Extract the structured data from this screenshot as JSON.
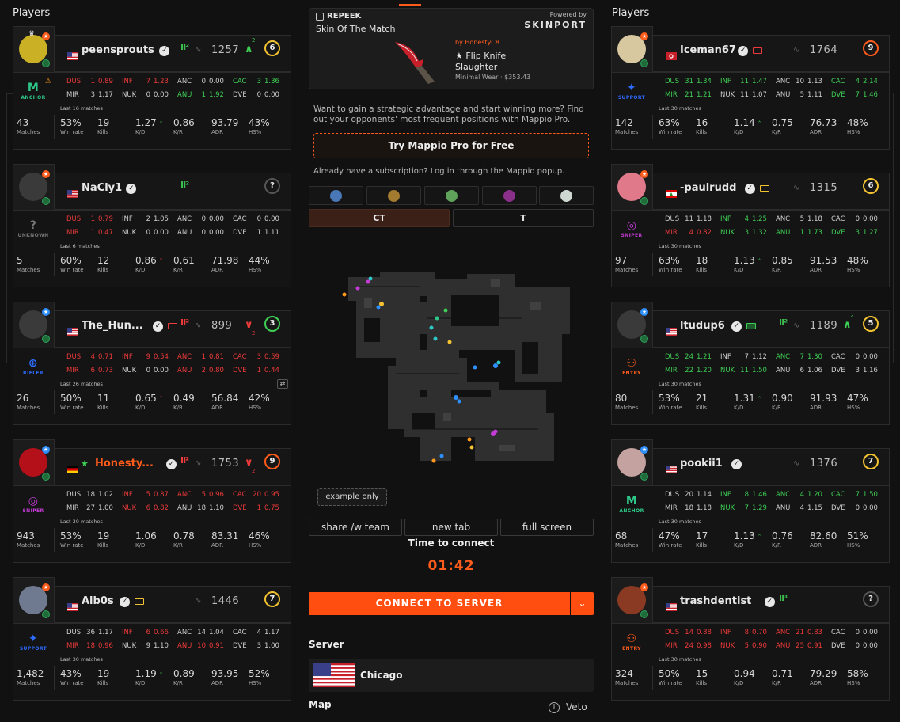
{
  "left_title": "Players",
  "right_title": "Players",
  "left_players": [
    {
      "name": "peensprouts",
      "name_color": "#e8e8e8",
      "flag": "us",
      "lvl": "Ⅱ²",
      "elo": "1257",
      "trend": "∧",
      "trend_sub": "2",
      "trend_color": "#3ecf55",
      "level": "6",
      "ring": "#f2c230",
      "role": "ANCHOR",
      "role_color": "#2ec98a",
      "role_icon": "M",
      "last": "Last 16 matches",
      "avatar_bg": "#c9b025",
      "dot": "#ff5c1c",
      "maps": [
        [
          "DUS",
          "1",
          "0.89",
          "INF",
          "7",
          "1.23",
          "ANC",
          "0",
          "0.00",
          "CAC",
          "3",
          "1.36"
        ],
        [
          "MIR",
          "3",
          "1.17",
          "NUK",
          "0",
          "0.00",
          "ANU",
          "1",
          "1.92",
          "DVE",
          "0",
          "0.00"
        ]
      ],
      "mapcolors": [
        [
          "rd",
          "rd",
          "w",
          "g"
        ],
        [
          "w",
          "w",
          "g",
          "w"
        ]
      ],
      "stats": {
        "matches": "43",
        "winrate": "53%",
        "kills": "19",
        "kd": "1.27",
        "kd_arrow": "˄",
        "kr": "0.86",
        "adr": "93.79",
        "hs": "43%"
      }
    },
    {
      "name": "NaCly1",
      "name_color": "#e8e8e8",
      "flag": "us",
      "lvl": "Ⅱ²",
      "elo": "",
      "trend": "",
      "trend_sub": "",
      "trend_color": "#3ecf55",
      "level": "?",
      "ring": "#555",
      "role": "UNKNOWN",
      "role_color": "#777",
      "role_icon": "?",
      "last": "Last 6 matches",
      "avatar_bg": "#3a3a3a",
      "dot": "#ff5c1c",
      "maps": [
        [
          "DUS",
          "1",
          "0.79",
          "INF",
          "2",
          "1.05",
          "ANC",
          "0",
          "0.00",
          "CAC",
          "0",
          "0.00"
        ],
        [
          "MIR",
          "1",
          "0.47",
          "NUK",
          "0",
          "0.00",
          "ANU",
          "0",
          "0.00",
          "DVE",
          "1",
          "1.11"
        ]
      ],
      "mapcolors": [
        [
          "rd",
          "w",
          "w",
          "w"
        ],
        [
          "rd",
          "w",
          "w",
          "w"
        ]
      ],
      "stats": {
        "matches": "5",
        "winrate": "60%",
        "kills": "12",
        "kd": "0.86",
        "kd_arrow": "˅",
        "kr": "0.61",
        "adr": "71.98",
        "hs": "44%"
      }
    },
    {
      "name": "The_Hun...",
      "name_color": "#e8e8e8",
      "flag": "us",
      "lvl": "Ⅱ²",
      "elo": "899",
      "trend": "∨",
      "trend_sub": "2",
      "trend_color": "#ee3a3a",
      "level": "3",
      "ring": "#3ecf55",
      "role": "RIFLER",
      "role_color": "#2e6bff",
      "role_icon": "⊕",
      "last": "Last 26 matches",
      "avatar_bg": "#3a3a3a",
      "dot": "#2e8fff",
      "maps": [
        [
          "DUS",
          "4",
          "0.71",
          "INF",
          "9",
          "0.54",
          "ANC",
          "1",
          "0.81",
          "CAC",
          "3",
          "0.59"
        ],
        [
          "MIR",
          "6",
          "0.73",
          "NUK",
          "0",
          "0.00",
          "ANU",
          "2",
          "0.80",
          "DVE",
          "1",
          "0.44"
        ]
      ],
      "mapcolors": [
        [
          "rd",
          "rd",
          "rd",
          "rd"
        ],
        [
          "rd",
          "w",
          "rd",
          "rd"
        ]
      ],
      "stats": {
        "matches": "26",
        "winrate": "50%",
        "kills": "11",
        "kd": "0.65",
        "kd_arrow": "˅",
        "kr": "0.49",
        "adr": "56.84",
        "hs": "42%"
      }
    },
    {
      "name": "Honesty...",
      "name_color": "#ff5c1c",
      "flag": "de",
      "lvl": "Ⅱ²",
      "elo": "1753",
      "trend": "∨",
      "trend_sub": "2",
      "trend_color": "#ee3a3a",
      "level": "9",
      "ring": "#ff5c1c",
      "role": "SNIPER",
      "role_color": "#c43bd6",
      "role_icon": "◎",
      "last": "Last 30 matches",
      "avatar_bg": "#b3101a",
      "dot": "#2e8fff",
      "maps": [
        [
          "DUS",
          "18",
          "1.02",
          "INF",
          "5",
          "0.87",
          "ANC",
          "5",
          "0.96",
          "CAC",
          "20",
          "0.95"
        ],
        [
          "MIR",
          "27",
          "1.00",
          "NUK",
          "6",
          "0.82",
          "ANU",
          "18",
          "1.10",
          "DVE",
          "1",
          "0.75"
        ]
      ],
      "mapcolors": [
        [
          "w",
          "rd",
          "rd",
          "rd"
        ],
        [
          "w",
          "rd",
          "w",
          "rd"
        ]
      ],
      "stats": {
        "matches": "943",
        "winrate": "53%",
        "kills": "19",
        "kd": "1.06",
        "kd_arrow": "",
        "kr": "0.78",
        "adr": "83.31",
        "hs": "46%"
      }
    },
    {
      "name": "Alb0s",
      "name_color": "#e8e8e8",
      "flag": "us",
      "lvl": "",
      "elo": "1446",
      "trend": "",
      "trend_sub": "",
      "trend_color": "#3ecf55",
      "level": "7",
      "ring": "#f2c230",
      "role": "SUPPORT",
      "role_color": "#2e6bff",
      "role_icon": "✦",
      "last": "Last 30 matches",
      "avatar_bg": "#6f7a90",
      "dot": "#ff5c1c",
      "maps": [
        [
          "DUS",
          "36",
          "1.17",
          "INF",
          "6",
          "0.66",
          "ANC",
          "14",
          "1.04",
          "CAC",
          "4",
          "1.17"
        ],
        [
          "MIR",
          "18",
          "0.96",
          "NUK",
          "9",
          "1.10",
          "ANU",
          "10",
          "0.91",
          "DVE",
          "3",
          "1.00"
        ]
      ],
      "mapcolors": [
        [
          "w",
          "rd",
          "w",
          "w"
        ],
        [
          "rd",
          "w",
          "rd",
          "w"
        ]
      ],
      "stats": {
        "matches": "1,482",
        "winrate": "43%",
        "kills": "19",
        "kd": "1.19",
        "kd_arrow": "˄",
        "kr": "0.89",
        "adr": "93.95",
        "hs": "52%"
      }
    }
  ],
  "right_players": [
    {
      "name": "Iceman67",
      "name_color": "#e8e8e8",
      "flag": "kr",
      "lvl": "",
      "elo": "1764",
      "trend": "",
      "trend_sub": "",
      "trend_color": "#3ecf55",
      "level": "9",
      "ring": "#ff5c1c",
      "role": "SUPPORT",
      "role_color": "#2e6bff",
      "role_icon": "✦",
      "last": "Last 30 matches",
      "avatar_bg": "#d8c8a0",
      "dot": "#ff5c1c",
      "maps": [
        [
          "DUS",
          "31",
          "1.34",
          "INF",
          "11",
          "1.47",
          "ANC",
          "10",
          "1.13",
          "CAC",
          "4",
          "2.14"
        ],
        [
          "MIR",
          "21",
          "1.21",
          "NUK",
          "11",
          "1.07",
          "ANU",
          "5",
          "1.11",
          "DVE",
          "7",
          "1.46"
        ]
      ],
      "mapcolors": [
        [
          "g",
          "g",
          "w",
          "g"
        ],
        [
          "g",
          "w",
          "w",
          "g"
        ]
      ],
      "stats": {
        "matches": "142",
        "winrate": "63%",
        "kills": "16",
        "kd": "1.14",
        "kd_arrow": "˄",
        "kr": "0.75",
        "adr": "76.73",
        "hs": "48%"
      }
    },
    {
      "name": "-paulrudd",
      "name_color": "#e8e8e8",
      "flag": "lb",
      "lvl": "",
      "elo": "1315",
      "trend": "",
      "trend_sub": "",
      "trend_color": "#3ecf55",
      "level": "6",
      "ring": "#f2c230",
      "role": "SNIPER",
      "role_color": "#c43bd6",
      "role_icon": "◎",
      "last": "Last 30 matches",
      "avatar_bg": "#e07a8a",
      "dot": "#ff5c1c",
      "maps": [
        [
          "DUS",
          "11",
          "1.18",
          "INF",
          "4",
          "1.25",
          "ANC",
          "5",
          "1.18",
          "CAC",
          "0",
          "0.00"
        ],
        [
          "MIR",
          "4",
          "0.82",
          "NUK",
          "3",
          "1.32",
          "ANU",
          "1",
          "1.73",
          "DVE",
          "3",
          "1.27"
        ]
      ],
      "mapcolors": [
        [
          "w",
          "g",
          "w",
          "w"
        ],
        [
          "rd",
          "g",
          "g",
          "g"
        ]
      ],
      "stats": {
        "matches": "97",
        "winrate": "63%",
        "kills": "18",
        "kd": "1.13",
        "kd_arrow": "˄",
        "kr": "0.85",
        "adr": "91.53",
        "hs": "48%"
      }
    },
    {
      "name": "ltudup6",
      "name_color": "#e8e8e8",
      "flag": "us",
      "lvl": "Ⅱ²",
      "elo": "1189",
      "trend": "∧",
      "trend_sub": "2",
      "trend_color": "#3ecf55",
      "level": "5",
      "ring": "#f2c230",
      "role": "ENTRY",
      "role_color": "#ff5c1c",
      "role_icon": "⚇",
      "last": "Last 30 matches",
      "avatar_bg": "#3a3a3a",
      "dot": "#2e8fff",
      "maps": [
        [
          "DUS",
          "24",
          "1.21",
          "INF",
          "7",
          "1.12",
          "ANC",
          "7",
          "1.30",
          "CAC",
          "0",
          "0.00"
        ],
        [
          "MIR",
          "22",
          "1.20",
          "NUK",
          "11",
          "1.50",
          "ANU",
          "6",
          "1.06",
          "DVE",
          "3",
          "1.16"
        ]
      ],
      "mapcolors": [
        [
          "g",
          "w",
          "g",
          "w"
        ],
        [
          "g",
          "g",
          "w",
          "w"
        ]
      ],
      "stats": {
        "matches": "80",
        "winrate": "53%",
        "kills": "21",
        "kd": "1.31",
        "kd_arrow": "˄",
        "kr": "0.90",
        "adr": "91.93",
        "hs": "47%"
      }
    },
    {
      "name": "pookii1",
      "name_color": "#e8e8e8",
      "flag": "us",
      "lvl": "",
      "elo": "1376",
      "trend": "",
      "trend_sub": "",
      "trend_color": "#3ecf55",
      "level": "7",
      "ring": "#f2c230",
      "role": "ANCHOR",
      "role_color": "#2ec98a",
      "role_icon": "M",
      "last": "Last 30 matches",
      "avatar_bg": "#c4a2a0",
      "dot": "#2e8fff",
      "maps": [
        [
          "DUS",
          "20",
          "1.14",
          "INF",
          "8",
          "1.46",
          "ANC",
          "4",
          "1.20",
          "CAC",
          "7",
          "1.50"
        ],
        [
          "MIR",
          "18",
          "1.18",
          "NUK",
          "7",
          "1.29",
          "ANU",
          "4",
          "1.15",
          "DVE",
          "0",
          "0.00"
        ]
      ],
      "mapcolors": [
        [
          "w",
          "g",
          "g",
          "g"
        ],
        [
          "w",
          "g",
          "w",
          "w"
        ]
      ],
      "stats": {
        "matches": "68",
        "winrate": "47%",
        "kills": "17",
        "kd": "1.13",
        "kd_arrow": "˄",
        "kr": "0.76",
        "adr": "82.60",
        "hs": "51%"
      }
    },
    {
      "name": "trashdentist",
      "name_color": "#e8e8e8",
      "flag": "us",
      "lvl": "Ⅱ³",
      "elo": "",
      "trend": "",
      "trend_sub": "",
      "trend_color": "#3ecf55",
      "level": "?",
      "ring": "#555",
      "role": "ENTRY",
      "role_color": "#ff5c1c",
      "role_icon": "⚇",
      "last": "Last 30 matches",
      "avatar_bg": "#8a3a22",
      "dot": "#ff5c1c",
      "maps": [
        [
          "DUS",
          "14",
          "0.88",
          "INF",
          "8",
          "0.70",
          "ANC",
          "21",
          "0.83",
          "CAC",
          "0",
          "0.00"
        ],
        [
          "MIR",
          "24",
          "0.98",
          "NUK",
          "5",
          "0.90",
          "ANU",
          "25",
          "0.91",
          "DVE",
          "0",
          "0.00"
        ]
      ],
      "mapcolors": [
        [
          "rd",
          "rd",
          "rd",
          "w"
        ],
        [
          "rd",
          "rd",
          "rd",
          "w"
        ]
      ],
      "stats": {
        "matches": "324",
        "winrate": "50%",
        "kills": "15",
        "kd": "0.94",
        "kd_arrow": "",
        "kr": "0.71",
        "adr": "79.29",
        "hs": "58%"
      }
    }
  ],
  "stat_labels": {
    "matches": "Matches",
    "winrate": "Win rate",
    "kills": "Kills",
    "kd": "K/D",
    "kr": "K/R",
    "adr": "ADR",
    "hs": "HS%"
  },
  "promo": {
    "brand": "REPEEK",
    "title": "Skin Of The Match",
    "powered": "Powered by",
    "sponsor": "SKINPORT",
    "by": "by HonestyC8",
    "item": "★ Flip Knife",
    "skin": "Slaughter",
    "price": "Minimal Wear · $353.43"
  },
  "mappio": {
    "text": "Want to gain a strategic advantage and start winning more? Find out your opponents' most frequent positions with Mappio Pro.",
    "button": "Try Mappio Pro for Free",
    "sub": "Already have a subscription? Log in through the Mappio popup."
  },
  "sides": {
    "ct": "CT",
    "t": "T"
  },
  "map_badge": "example only",
  "map_buttons": {
    "share": "share /w team",
    "newtab": "new tab",
    "fullscreen": "full screen"
  },
  "connect": {
    "label": "Time to connect",
    "timer": "01:42",
    "button": "CONNECT TO SERVER"
  },
  "server": {
    "label": "Server",
    "city": "Chicago"
  },
  "map_section": {
    "label": "Map",
    "veto": "Veto"
  },
  "colors": {
    "accent": "#ff4e0f",
    "bg": "#111111",
    "card": "#161616"
  }
}
